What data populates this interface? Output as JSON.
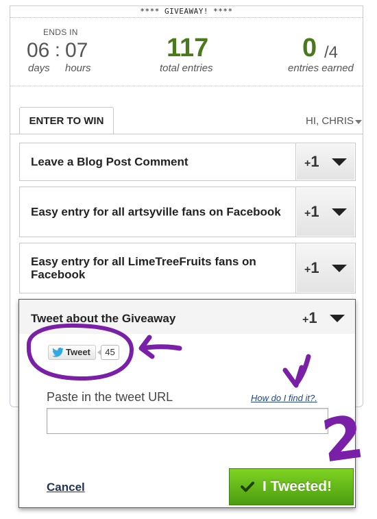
{
  "banner": "**** GIVEAWAY! ****",
  "countdown": {
    "caption": "ENDS IN",
    "days": "06",
    "separator": ":",
    "hours": "07",
    "days_label": "days",
    "hours_label": "hours"
  },
  "total": {
    "value": "117",
    "label": "total entries"
  },
  "earned": {
    "value": "0",
    "max": "/4",
    "label": "entries earned"
  },
  "tab": {
    "label": "ENTER TO WIN"
  },
  "user": {
    "greeting": "HI, CHRIS"
  },
  "entries": [
    {
      "title": "Leave a Blog Post Comment",
      "plus": "+",
      "points": "1"
    },
    {
      "title": "Easy entry for all artsyville fans on Facebook",
      "plus": "+",
      "points": "1"
    },
    {
      "title": "Easy entry for all LimeTreeFruits fans on Facebook",
      "plus": "+",
      "points": "1"
    }
  ],
  "tweet_entry": {
    "title": "Tweet about the Giveaway",
    "plus": "+",
    "points": "1",
    "tweet_button": "Tweet",
    "tweet_count": "45",
    "url_label": "Paste in the tweet URL",
    "help_link": "How do I find it?.",
    "cancel": "Cancel",
    "submit": "I Tweeted!"
  },
  "annotations": {
    "number": "2"
  },
  "colors": {
    "accent_green": "#4a7a1c",
    "button_green": "#6ec11e",
    "annotation_purple": "#7a1fa8"
  },
  "icons": [
    "twitter-bird-icon",
    "checkmark-icon",
    "chevron-down-icon"
  ]
}
